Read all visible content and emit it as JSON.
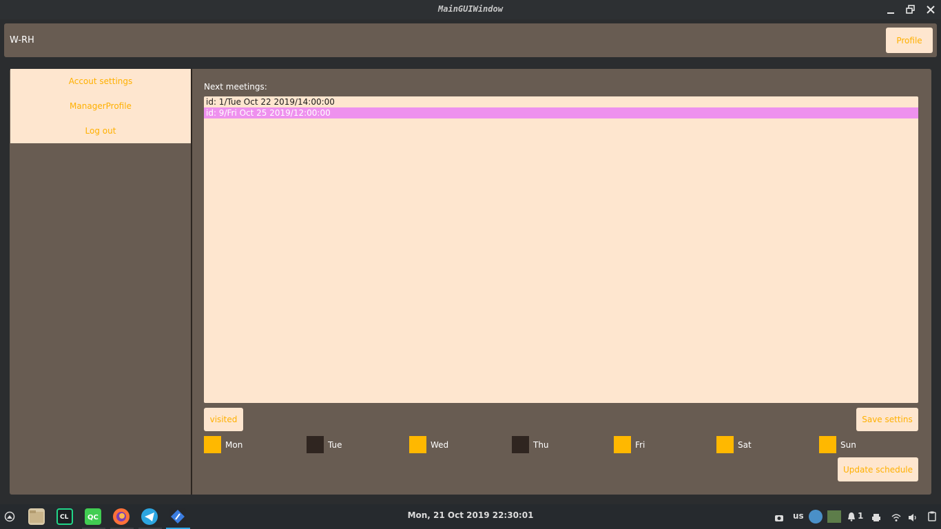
{
  "window": {
    "title": "MainGUIWindow"
  },
  "header": {
    "username": "W-RH",
    "profile_label": "Profile"
  },
  "sidebar": {
    "items": [
      {
        "label": "Accout settings"
      },
      {
        "label": "ManagerProfile"
      },
      {
        "label": "Log out"
      }
    ]
  },
  "meetings": {
    "heading": "Next meetings:",
    "items": [
      {
        "text": "id: 1/Tue Oct 22 2019/14:00:00",
        "selected": false
      },
      {
        "text": "id: 9/Fri Oct 25 2019/12:00:00",
        "selected": true
      }
    ]
  },
  "buttons": {
    "visited": "visited",
    "save": "Save settins",
    "update": "Update schedule"
  },
  "days": [
    {
      "label": "Mon",
      "checked": true
    },
    {
      "label": "Tue",
      "checked": false
    },
    {
      "label": "Wed",
      "checked": true
    },
    {
      "label": "Thu",
      "checked": false
    },
    {
      "label": "Fri",
      "checked": true
    },
    {
      "label": "Sat",
      "checked": true
    },
    {
      "label": "Sun",
      "checked": true
    }
  ],
  "taskbar": {
    "clock": "Mon, 21 Oct 2019 22:30:01",
    "keyboard_layout": "us",
    "notification_count": "1",
    "apps": [
      "files-icon",
      "clion-icon",
      "qt-creator-icon",
      "firefox-icon",
      "telegram-icon",
      "gui-app-icon"
    ]
  },
  "colors": {
    "accent": "#ffb000",
    "panel": "#685c52",
    "light": "#fee6cf",
    "selection": "#ee91ee"
  }
}
